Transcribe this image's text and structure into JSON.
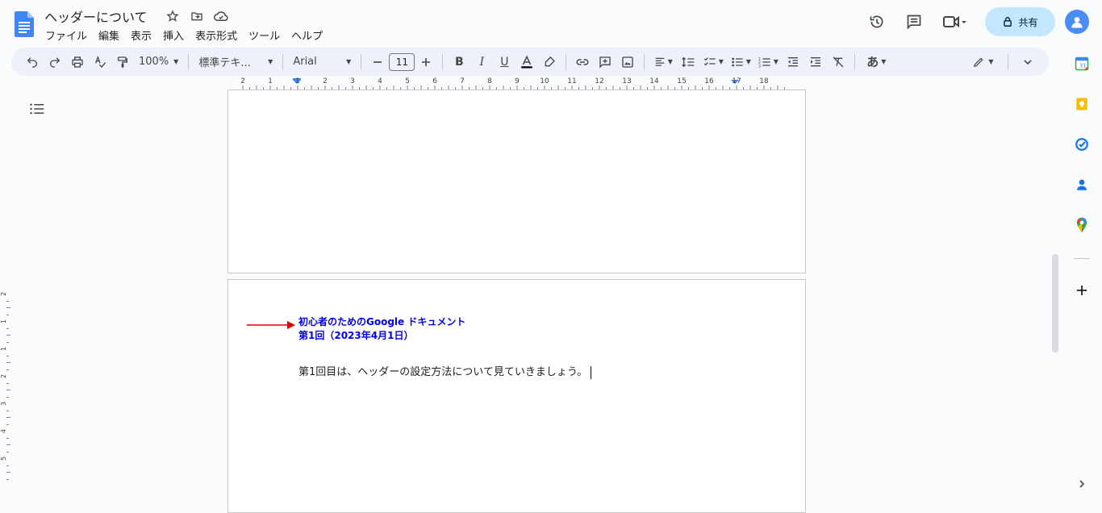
{
  "doc": {
    "title": "ヘッダーについて",
    "menu": [
      "ファイル",
      "編集",
      "表示",
      "挿入",
      "表示形式",
      "ツール",
      "ヘルプ"
    ]
  },
  "actions": {
    "share_label": "共有"
  },
  "toolbar": {
    "zoom": "100%",
    "style": "標準テキ...",
    "font": "Arial",
    "font_size": "11",
    "input_tool": "あ"
  },
  "ruler": {
    "ticks": [
      "2",
      "1",
      "1",
      "2",
      "3",
      "4",
      "5",
      "6",
      "7",
      "8",
      "9",
      "10",
      "11",
      "12",
      "13",
      "14",
      "15",
      "16",
      "17",
      "18"
    ]
  },
  "vruler": {
    "ticks": [
      "2",
      "1",
      "1",
      "2",
      "3",
      "4",
      "5"
    ]
  },
  "page": {
    "header_line1": "初心者のためのGoogle ドキュメント",
    "header_line2": "第1回（2023年4月1日）",
    "body": "第1回目は、ヘッダーの設定方法について見ていきましょう。"
  },
  "colors": {
    "header_text": "#0000ee",
    "arrow": "#e00000",
    "share_bg": "#c2e7ff",
    "toolbar_bg": "#edf2fa"
  }
}
